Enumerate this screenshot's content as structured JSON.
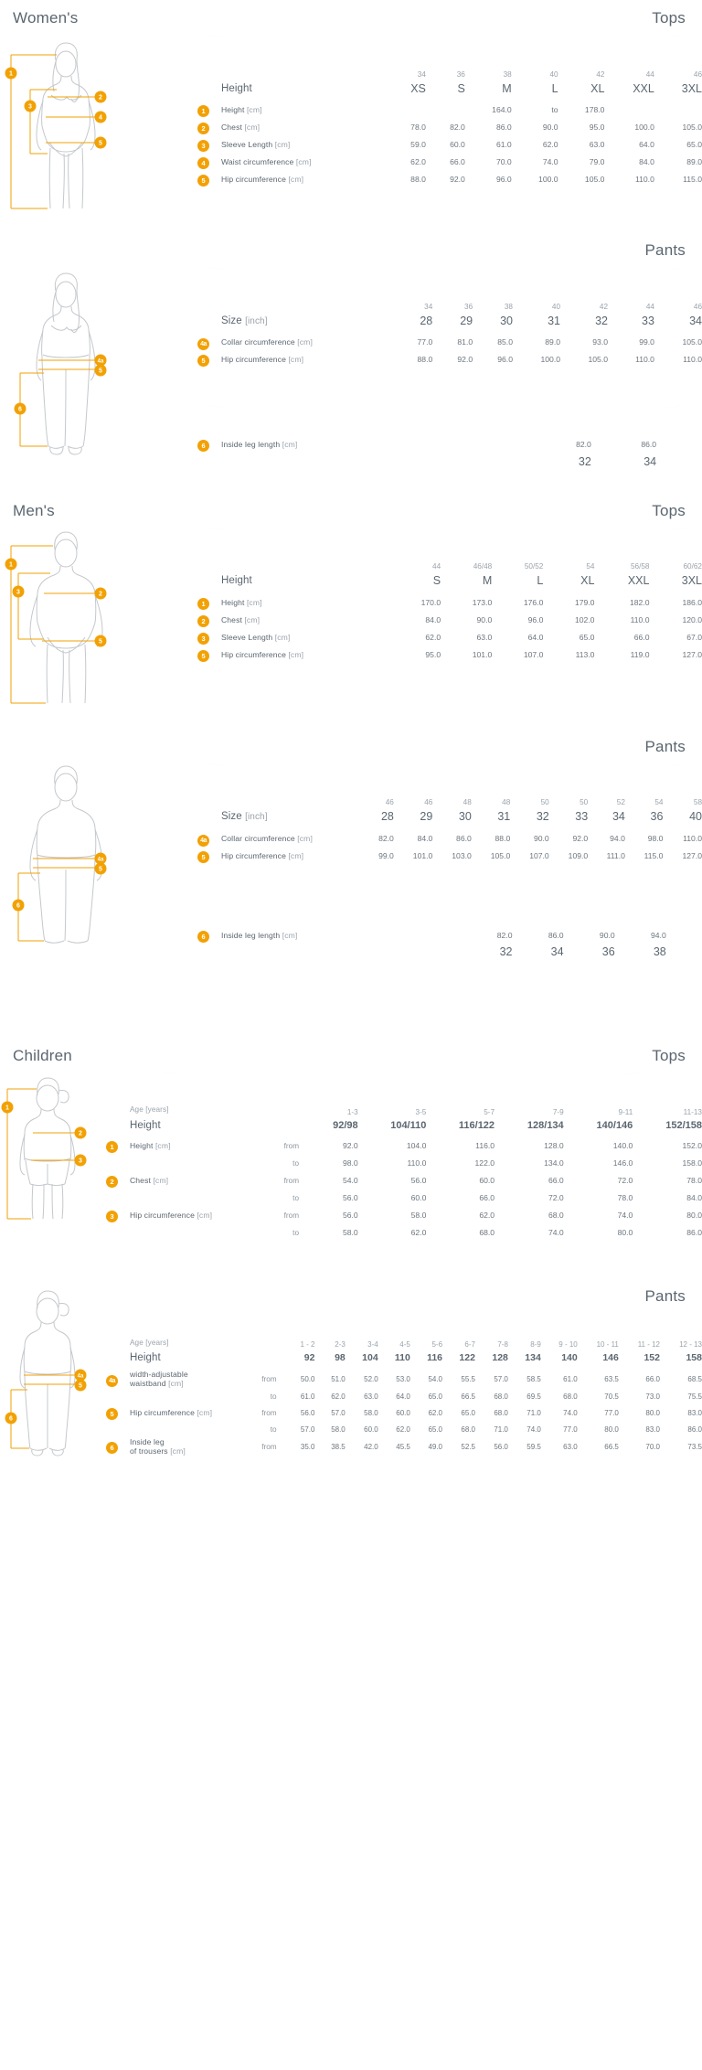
{
  "sections": {
    "womens": {
      "title": "Women's",
      "tops": {
        "kind": "Tops",
        "size_numbers": [
          "34",
          "36",
          "38",
          "40",
          "42",
          "44",
          "46"
        ],
        "size_letters": [
          "XS",
          "S",
          "M",
          "L",
          "XL",
          "XXL",
          "3XL"
        ],
        "header_label": "Height",
        "rows": [
          {
            "badge": "1",
            "label": "Height",
            "unit": "[cm]",
            "special": "range",
            "range": [
              "164.0",
              "to",
              "178.0"
            ]
          },
          {
            "badge": "2",
            "label": "Chest",
            "unit": "[cm]",
            "values": [
              "78.0",
              "82.0",
              "86.0",
              "90.0",
              "95.0",
              "100.0",
              "105.0"
            ]
          },
          {
            "badge": "3",
            "label": "Sleeve Length",
            "unit": "[cm]",
            "values": [
              "59.0",
              "60.0",
              "61.0",
              "62.0",
              "63.0",
              "64.0",
              "65.0"
            ]
          },
          {
            "badge": "4",
            "label": "Waist circumference",
            "unit": "[cm]",
            "values": [
              "62.0",
              "66.0",
              "70.0",
              "74.0",
              "79.0",
              "84.0",
              "89.0"
            ]
          },
          {
            "badge": "5",
            "label": "Hip circumference",
            "unit": "[cm]",
            "values": [
              "88.0",
              "92.0",
              "96.0",
              "100.0",
              "105.0",
              "110.0",
              "115.0"
            ]
          }
        ]
      },
      "pants": {
        "kind": "Pants",
        "size_numbers": [
          "34",
          "36",
          "38",
          "40",
          "42",
          "44",
          "46"
        ],
        "size_inches": [
          "28",
          "29",
          "30",
          "31",
          "32",
          "33",
          "34"
        ],
        "header_label": "Size",
        "header_unit": "[inch]",
        "rows": [
          {
            "badge": "4a",
            "label": "Collar circumference",
            "unit": "[cm]",
            "values": [
              "77.0",
              "81.0",
              "85.0",
              "89.0",
              "93.0",
              "99.0",
              "105.0"
            ]
          },
          {
            "badge": "5",
            "label": "Hip circumference",
            "unit": "[cm]",
            "values": [
              "88.0",
              "92.0",
              "96.0",
              "100.0",
              "105.0",
              "110.0",
              "110.0"
            ]
          }
        ],
        "inside_leg": {
          "badge": "6",
          "label": "Inside leg length",
          "unit": "[cm]",
          "values": [
            "82.0",
            "86.0"
          ],
          "inches": [
            "32",
            "34"
          ]
        }
      }
    },
    "mens": {
      "title": "Men's",
      "tops": {
        "kind": "Tops",
        "size_numbers": [
          "44",
          "46/48",
          "50/52",
          "54",
          "56/58",
          "60/62"
        ],
        "size_letters": [
          "S",
          "M",
          "L",
          "XL",
          "XXL",
          "3XL"
        ],
        "header_label": "Height",
        "rows": [
          {
            "badge": "1",
            "label": "Height",
            "unit": "[cm]",
            "values": [
              "170.0",
              "173.0",
              "176.0",
              "179.0",
              "182.0",
              "186.0"
            ]
          },
          {
            "badge": "2",
            "label": "Chest",
            "unit": "[cm]",
            "values": [
              "84.0",
              "90.0",
              "96.0",
              "102.0",
              "110.0",
              "120.0"
            ]
          },
          {
            "badge": "3",
            "label": "Sleeve Length",
            "unit": "[cm]",
            "values": [
              "62.0",
              "63.0",
              "64.0",
              "65.0",
              "66.0",
              "67.0"
            ]
          },
          {
            "badge": "5",
            "label": "Hip circumference",
            "unit": "[cm]",
            "values": [
              "95.0",
              "101.0",
              "107.0",
              "113.0",
              "119.0",
              "127.0"
            ]
          }
        ]
      },
      "pants": {
        "kind": "Pants",
        "size_numbers": [
          "46",
          "46",
          "48",
          "48",
          "50",
          "50",
          "52",
          "54",
          "58"
        ],
        "size_inches": [
          "28",
          "29",
          "30",
          "31",
          "32",
          "33",
          "34",
          "36",
          "40"
        ],
        "header_label": "Size",
        "header_unit": "[inch]",
        "rows": [
          {
            "badge": "4a",
            "label": "Collar circumference",
            "unit": "[cm]",
            "values": [
              "82.0",
              "84.0",
              "86.0",
              "88.0",
              "90.0",
              "92.0",
              "94.0",
              "98.0",
              "110.0"
            ]
          },
          {
            "badge": "5",
            "label": "Hip circumference",
            "unit": "[cm]",
            "values": [
              "99.0",
              "101.0",
              "103.0",
              "105.0",
              "107.0",
              "109.0",
              "111.0",
              "115.0",
              "127.0"
            ]
          }
        ],
        "inside_leg": {
          "badge": "6",
          "label": "Inside leg length",
          "unit": "[cm]",
          "values": [
            "82.0",
            "86.0",
            "90.0",
            "94.0"
          ],
          "inches": [
            "32",
            "34",
            "36",
            "38"
          ]
        }
      }
    },
    "children": {
      "title": "Children",
      "tops": {
        "kind": "Tops",
        "age_label": "Age",
        "age_unit": "[years]",
        "ages": [
          "1-3",
          "3-5",
          "5-7",
          "7-9",
          "9-11",
          "11-13"
        ],
        "height_label": "Height",
        "heights": [
          "92/98",
          "104/110",
          "116/122",
          "128/134",
          "140/146",
          "152/158"
        ],
        "from_label": "from",
        "to_label": "to",
        "rows": [
          {
            "badge": "1",
            "label": "Height",
            "unit": "[cm]",
            "from": [
              "92.0",
              "104.0",
              "116.0",
              "128.0",
              "140.0",
              "152.0"
            ],
            "to": [
              "98.0",
              "110.0",
              "122.0",
              "134.0",
              "146.0",
              "158.0"
            ]
          },
          {
            "badge": "2",
            "label": "Chest",
            "unit": "[cm]",
            "from": [
              "54.0",
              "56.0",
              "60.0",
              "66.0",
              "72.0",
              "78.0"
            ],
            "to": [
              "56.0",
              "60.0",
              "66.0",
              "72.0",
              "78.0",
              "84.0"
            ]
          },
          {
            "badge": "3",
            "label": "Hip circumference",
            "unit": "[cm]",
            "from": [
              "56.0",
              "58.0",
              "62.0",
              "68.0",
              "74.0",
              "80.0"
            ],
            "to": [
              "58.0",
              "62.0",
              "68.0",
              "74.0",
              "80.0",
              "86.0"
            ]
          }
        ]
      },
      "pants": {
        "kind": "Pants",
        "age_label": "Age",
        "age_unit": "[years]",
        "ages": [
          "1 - 2",
          "2-3",
          "3-4",
          "4-5",
          "5-6",
          "6-7",
          "7-8",
          "8-9",
          "9 - 10",
          "10 - 11",
          "11 - 12",
          "12 - 13"
        ],
        "height_label": "Height",
        "heights": [
          "92",
          "98",
          "104",
          "110",
          "116",
          "122",
          "128",
          "134",
          "140",
          "146",
          "152",
          "158"
        ],
        "from_label": "from",
        "to_label": "to",
        "rows": [
          {
            "badge": "4a",
            "label": "width-adjustable",
            "label2": "waistband",
            "unit": "[cm]",
            "from": [
              "50.0",
              "51.0",
              "52.0",
              "53.0",
              "54.0",
              "55.5",
              "57.0",
              "58.5",
              "61.0",
              "63.5",
              "66.0",
              "68.5"
            ],
            "to": [
              "61.0",
              "62.0",
              "63.0",
              "64.0",
              "65.0",
              "66.5",
              "68.0",
              "69.5",
              "68.0",
              "70.5",
              "73.0",
              "75.5"
            ]
          },
          {
            "badge": "5",
            "label": "Hip circumference",
            "unit": "[cm]",
            "from": [
              "56.0",
              "57.0",
              "58.0",
              "60.0",
              "62.0",
              "65.0",
              "68.0",
              "71.0",
              "74.0",
              "77.0",
              "80.0",
              "83.0"
            ],
            "to": [
              "57.0",
              "58.0",
              "60.0",
              "62.0",
              "65.0",
              "68.0",
              "71.0",
              "74.0",
              "77.0",
              "80.0",
              "83.0",
              "86.0"
            ]
          },
          {
            "badge": "6",
            "label": "Inside leg",
            "label2": "of trousers",
            "unit": "[cm]",
            "from": [
              "35.0",
              "38.5",
              "42.0",
              "45.5",
              "49.0",
              "52.5",
              "56.0",
              "59.5",
              "63.0",
              "66.5",
              "70.0",
              "73.5"
            ]
          }
        ]
      }
    }
  },
  "colors": {
    "accent": "#f2a104",
    "text": "#5b6670",
    "muted": "#9aa3ab",
    "figure_line": "#b9bec3"
  }
}
